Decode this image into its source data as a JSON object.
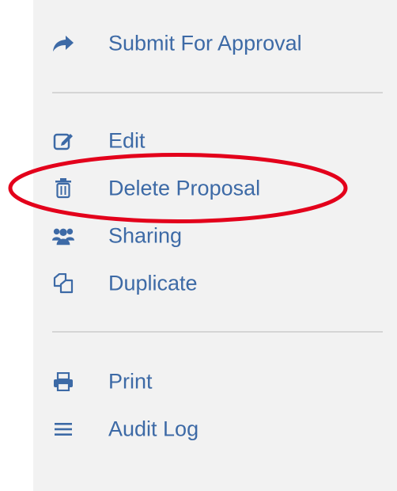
{
  "menu": {
    "submit_label": "Submit For Approval",
    "edit_label": "Edit",
    "delete_label": "Delete Proposal",
    "sharing_label": "Sharing",
    "duplicate_label": "Duplicate",
    "print_label": "Print",
    "audit_log_label": "Audit Log"
  },
  "icons": {
    "submit": "share-arrow-icon",
    "edit": "edit-icon",
    "delete": "trash-icon",
    "sharing": "users-icon",
    "duplicate": "duplicate-icon",
    "print": "print-icon",
    "audit_log": "list-icon"
  },
  "colors": {
    "accent": "#3d6aa6",
    "panel_background": "#f2f2f2",
    "divider": "#d5d5d5",
    "annotation_red": "#e3001b"
  }
}
